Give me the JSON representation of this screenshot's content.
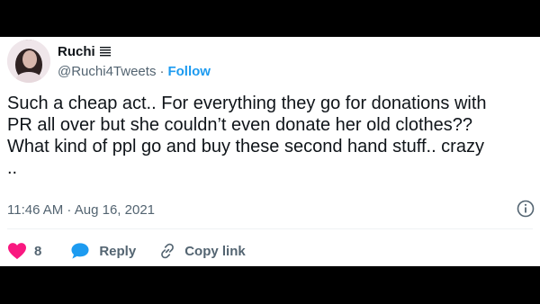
{
  "user": {
    "display_name": "Ruchi",
    "handle": "@Ruchi4Tweets",
    "separator": "·",
    "follow_label": "Follow"
  },
  "tweet": {
    "text": "Such a cheap act.. For everything they go for donations with\nPR all over but she couldn’t even donate her old clothes??\nWhat kind of ppl go and buy these second hand stuff.. crazy\n..",
    "timestamp": "11:46 AM · Aug 16, 2021"
  },
  "actions": {
    "like_count": "8",
    "reply_label": "Reply",
    "copy_link_label": "Copy link"
  },
  "icons": {
    "like": "heart-icon",
    "reply": "speech-bubble-icon",
    "copy_link": "link-icon",
    "info": "info-icon",
    "name_badge": "list-badge-icon"
  },
  "colors": {
    "like": "#f91880",
    "reply": "#1d9bf0",
    "follow": "#1d9bf0",
    "secondary_text": "#536471"
  }
}
